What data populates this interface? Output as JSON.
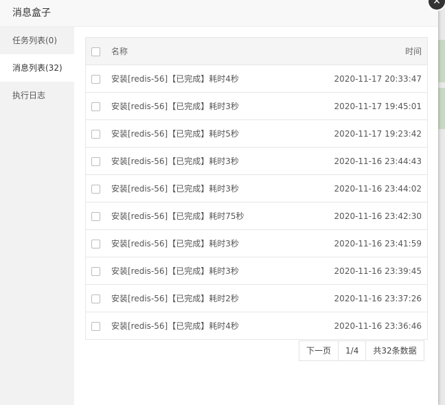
{
  "dialog": {
    "title": "消息盒子"
  },
  "sidebar": {
    "items": [
      {
        "label": "任务列表(0)"
      },
      {
        "label": "消息列表(32)"
      },
      {
        "label": "执行日志"
      }
    ]
  },
  "table": {
    "headers": {
      "name": "名称",
      "time": "时间"
    },
    "rows": [
      {
        "name": "安装[redis-56]【已完成】耗时4秒",
        "time": "2020-11-17 20:33:47"
      },
      {
        "name": "安装[redis-56]【已完成】耗时3秒",
        "time": "2020-11-17 19:45:01"
      },
      {
        "name": "安装[redis-56]【已完成】耗时5秒",
        "time": "2020-11-17 19:23:42"
      },
      {
        "name": "安装[redis-56]【已完成】耗时3秒",
        "time": "2020-11-16 23:44:43"
      },
      {
        "name": "安装[redis-56]【已完成】耗时3秒",
        "time": "2020-11-16 23:44:02"
      },
      {
        "name": "安装[redis-56]【已完成】耗时75秒",
        "time": "2020-11-16 23:42:30"
      },
      {
        "name": "安装[redis-56]【已完成】耗时3秒",
        "time": "2020-11-16 23:41:59"
      },
      {
        "name": "安装[redis-56]【已完成】耗时3秒",
        "time": "2020-11-16 23:39:45"
      },
      {
        "name": "安装[redis-56]【已完成】耗时2秒",
        "time": "2020-11-16 23:37:26"
      },
      {
        "name": "安装[redis-56]【已完成】耗时4秒",
        "time": "2020-11-16 23:36:46"
      }
    ]
  },
  "pager": {
    "next": "下一页",
    "page": "1/4",
    "total": "共32条数据"
  },
  "icons": {
    "close": "close-icon"
  }
}
